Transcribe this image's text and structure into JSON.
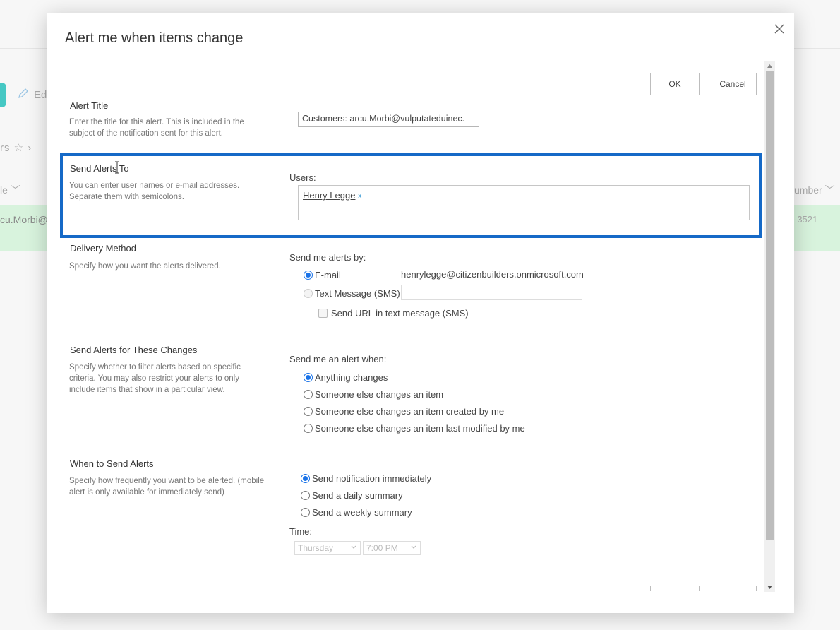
{
  "background": {
    "edit_label": "Edi",
    "breadcrumb_fragment": "rs",
    "column_left": "le",
    "column_right": "umber",
    "row_left_value": "cu.Morbi@",
    "row_right_value": "-3521"
  },
  "dialog": {
    "title": "Alert me when items change",
    "ok_label": "OK",
    "cancel_label": "Cancel",
    "sections": {
      "alert_title": {
        "title": "Alert Title",
        "description": "Enter the title for this alert. This is included in the subject of the notification sent for this alert.",
        "value": "Customers: arcu.Morbi@vulputateduinec."
      },
      "send_to": {
        "title": "Send Alerts To",
        "description": "You can enter user names or e-mail addresses. Separate them with semicolons.",
        "users_label": "Users:",
        "users": [
          {
            "name": "Henry Legge",
            "remove": "x"
          }
        ]
      },
      "delivery": {
        "title": "Delivery Method",
        "description": "Specify how you want the alerts delivered.",
        "field_label": "Send me alerts by:",
        "options": [
          {
            "label": "E-mail",
            "checked": true,
            "disabled": false
          },
          {
            "label": "Text Message (SMS)",
            "checked": false,
            "disabled": true
          }
        ],
        "email": "henrylegge@citizenbuilders.onmicrosoft.com",
        "sms_value": "",
        "send_url_label": "Send URL in text message (SMS)",
        "send_url_checked": false
      },
      "changes": {
        "title": "Send Alerts for These Changes",
        "description": "Specify whether to filter alerts based on specific criteria. You may also restrict your alerts to only include items that show in a particular view.",
        "field_label": "Send me an alert when:",
        "options": [
          {
            "label": "Anything changes",
            "checked": true
          },
          {
            "label": "Someone else changes an item",
            "checked": false
          },
          {
            "label": "Someone else changes an item created by me",
            "checked": false
          },
          {
            "label": "Someone else changes an item last modified by me",
            "checked": false
          }
        ]
      },
      "when": {
        "title": "When to Send Alerts",
        "description": "Specify how frequently you want to be alerted. (mobile alert is only available for immediately send)",
        "options": [
          {
            "label": "Send notification immediately",
            "checked": true
          },
          {
            "label": "Send a daily summary",
            "checked": false
          },
          {
            "label": "Send a weekly summary",
            "checked": false
          }
        ],
        "time_label": "Time:",
        "day_value": "Thursday",
        "time_value": "7:00 PM"
      }
    }
  },
  "colors": {
    "accent": "#1569c7",
    "radio_checked": "#1a73e8",
    "row_highlight": "#d8f3dd"
  }
}
